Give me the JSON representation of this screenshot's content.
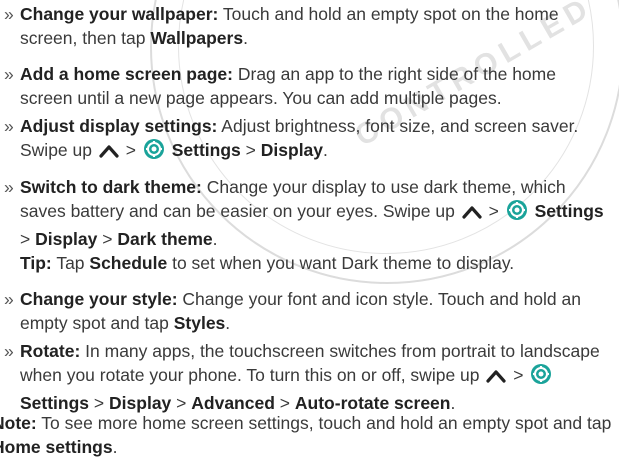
{
  "items": [
    {
      "title": "Change your wallpaper:",
      "text": "Touch and hold an empty spot on the home screen, then tap",
      "bold_end": "Wallpapers",
      "end": "."
    },
    {
      "title": "Add a home screen page:",
      "text": "Drag an app to the right side of the home screen until a new page appears. You can add multiple pages."
    },
    {
      "title": "Adjust display settings:",
      "text": "Adjust brightness, font size, and screen saver. Swipe up",
      "p1": "Settings",
      "p2": "Display"
    },
    {
      "title": "Switch to dark theme:",
      "text": "Change your display to use dark theme, which saves battery and can be easier on your eyes. Swipe up",
      "p1": "Settings",
      "p2": "Display",
      "p3": "Dark theme"
    },
    {
      "title": "Change your style:",
      "text": "Change your font and icon style. Touch and hold an empty spot and tap",
      "bold_end": "Styles",
      "end": "."
    },
    {
      "title": "Rotate:",
      "text": "In many apps, the touchscreen switches from portrait to landscape when you rotate your phone. To turn this on or off, swipe up",
      "p1": "Settings",
      "p2": "Display",
      "p3": "Advanced",
      "p4": "Auto-rotate screen"
    }
  ],
  "bullet": "»",
  "separator": ">",
  "tip": {
    "label": "Tip:",
    "pre": "Tap",
    "bold": "Schedule",
    "post": "to set when you want Dark theme to display."
  },
  "note": {
    "label": "Note:",
    "pre": "To see more home screen settings, touch and hold an empty spot and tap",
    "bold": "Home settings",
    "post": "."
  },
  "watermark_text": "CONTROLLED",
  "colors": {
    "icon": "#1aa39a",
    "arrow": "#222222",
    "watermark": "#dcdcdc"
  },
  "icons": [
    "chevron-up-icon",
    "settings-gear-icon"
  ]
}
